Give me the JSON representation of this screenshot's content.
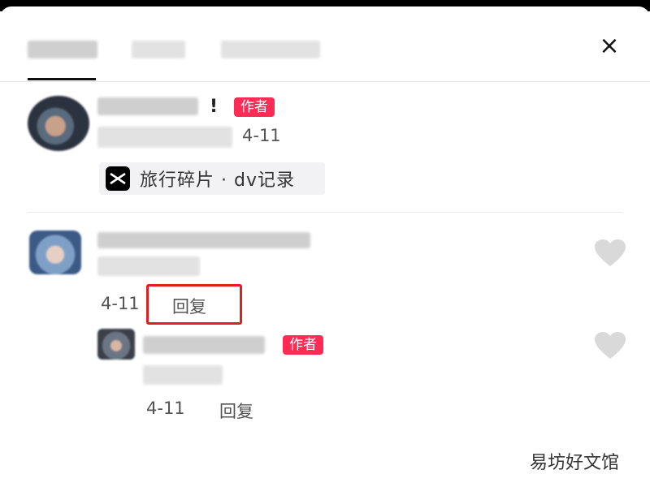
{
  "badges": {
    "author": "作者"
  },
  "comments": [
    {
      "time": "4-11",
      "exclamation": "!",
      "template_chip": {
        "icon": "capcut-icon",
        "label": "旅行碎片 · dv记录"
      }
    },
    {
      "time": "4-11",
      "reply_label": "回复"
    }
  ],
  "replies": [
    {
      "time": "4-11",
      "reply_label": "回复"
    }
  ],
  "close_icon": "×",
  "watermark": "易坊好文馆",
  "colors": {
    "badge": "#fe2c55",
    "highlight": "#e02020",
    "heart": "#d9d9d9"
  }
}
